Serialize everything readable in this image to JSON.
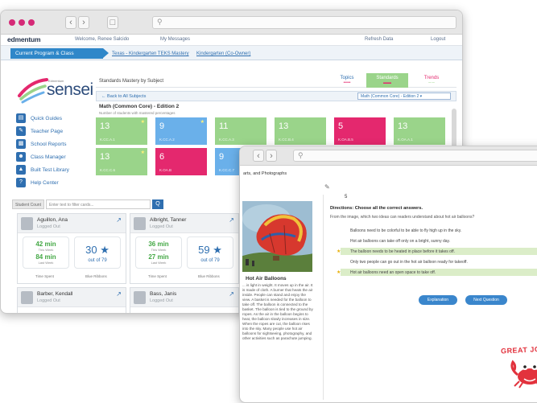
{
  "app1": {
    "brand": "edmentum",
    "nav": {
      "welcome": "Welcome, Renee Salcido",
      "messages": "My Messages",
      "refresh": "Refresh Data",
      "logout": "Logout"
    },
    "breadcrumb": {
      "active": "Current Program & Class",
      "items": [
        "Texas - Kindergarten TEKS Mastery",
        "Kindergarten (Co-Owner)"
      ]
    },
    "logo": {
      "top": "Edmentum",
      "main": "sensei"
    },
    "sidebar": [
      "Quick Guides",
      "Teacher Page",
      "School Reports",
      "Class Manager",
      "Built Test Library",
      "Help Center"
    ],
    "main": {
      "title": "Standards Mastery by Subject",
      "tabs": [
        "Topics",
        "Standards",
        "Trends"
      ],
      "back": "Back to All Subjects",
      "select": "Math (Common Core) - Edition 2",
      "section_title": "Math (Common Core) - Edition 2",
      "section_sub": "Number of students with mastered percentages",
      "tiles_row1": [
        {
          "num": "13",
          "code": "K.CC.A.1",
          "color": "#9ad48a",
          "star": true
        },
        {
          "num": "9",
          "code": "K.CC.A.2",
          "color": "#6ab0ea",
          "star": true
        },
        {
          "num": "11",
          "code": "K.CC.A.3",
          "color": "#9ad48a",
          "star": false
        },
        {
          "num": "13",
          "code": "K.CC.B.4",
          "color": "#9ad48a",
          "star": false
        },
        {
          "num": "5",
          "code": "K.OA.B.5",
          "color": "#e4286e",
          "star": false
        },
        {
          "num": "13",
          "code": "K.OA.A.1",
          "color": "#9ad48a",
          "star": false
        }
      ],
      "tiles_row2": [
        {
          "num": "13",
          "code": "K.CC.C.6",
          "color": "#9ad48a",
          "star": true
        },
        {
          "num": "6",
          "code": "K.OA.B",
          "color": "#e4286e",
          "star": false
        },
        {
          "num": "9",
          "code": "K.CC.C.7",
          "color": "#6ab0ea",
          "star": false
        }
      ]
    },
    "filter": {
      "label": "Student Count",
      "placeholder": "Enter text to filter cards...",
      "go": "Q"
    },
    "students": [
      {
        "name": "Aguillon, Ana",
        "status": "Logged Out",
        "min1": "42 min",
        "lbl1": "This Week",
        "min2": "84 min",
        "lbl2": "Last Week",
        "big": "30",
        "outof": "out of 79",
        "foot1": "Time Spent",
        "foot2": "Blue Ribbons"
      },
      {
        "name": "Albright, Tanner",
        "status": "Logged Out",
        "min1": "36 min",
        "lbl1": "This Week",
        "min2": "27 min",
        "lbl2": "Last Week",
        "big": "59",
        "outof": "out of 79",
        "foot1": "Time Spent",
        "foot2": "Blue Ribbons"
      },
      {
        "name": "Barber, Kendall",
        "status": "Logged Out"
      },
      {
        "name": "Bass, Janis",
        "status": "Logged Out"
      }
    ]
  },
  "app2": {
    "breadcrumb": "arts, and Photographs",
    "article": {
      "title": "Hot Air Balloons",
      "text": "... is light in weight. It moves up in the air. It is made of cloth. A burner that heats the air inside. People can stand and enjoy the view. A basket is needed for the balloon to take off. The balloon is connected to the basket. The balloon is tied to the ground by ropes. As the air in the balloon begins to heat, the balloon slowly increases in size. When the ropes are cut, the balloon rises into the sky. Many people use hot air balloons for sightseeing, photography, and other activities such as parachute jumping."
    },
    "question": {
      "number": "5",
      "directions": "Directions: Choose all the correct answers.",
      "prompt": "From the image, which two ideas can readers understand about hot air balloons?",
      "answers": [
        {
          "text": "Balloons need to be colorful to be able to fly high up in the sky.",
          "selected": false,
          "mark": ""
        },
        {
          "text": "Hot air balloons can take off only on a bright, sunny day.",
          "selected": false,
          "mark": ""
        },
        {
          "text": "The balloon needs to be heated in place before it takes off.",
          "selected": true,
          "mark": "★"
        },
        {
          "text": "Only two people can go out in the hot air balloon ready for takeoff.",
          "selected": false,
          "mark": ""
        },
        {
          "text": "Hot air balloons need an open space to take off.",
          "selected": true,
          "mark": "★"
        }
      ]
    },
    "buttons": {
      "explanation": "Explanation",
      "next": "Next Question"
    },
    "reward": "GREAT JOB!"
  }
}
